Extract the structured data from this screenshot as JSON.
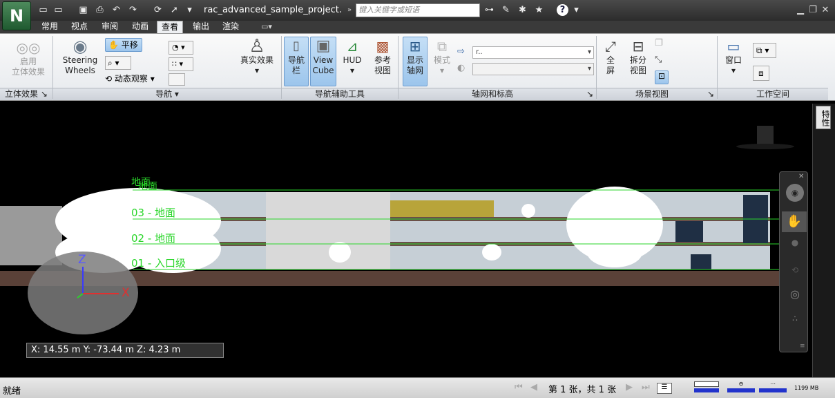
{
  "titlebar": {
    "app_logo": "N",
    "document_title": "rac_advanced_sample_project.n...",
    "search_placeholder": "键入关键字或短语",
    "qa_icons": [
      "new-icon",
      "open-icon",
      "save-icon",
      "print-icon",
      "undo-icon",
      "redo-icon",
      "refresh-icon",
      "select-icon",
      "dropdown-icon"
    ],
    "right_icons": [
      "binoculars-icon",
      "tools-icon",
      "satellite-icon",
      "star-icon",
      "help-icon"
    ]
  },
  "tabs": [
    {
      "label": "常用"
    },
    {
      "label": "视点"
    },
    {
      "label": "审阅"
    },
    {
      "label": "动画"
    },
    {
      "label": "查看",
      "active": true
    },
    {
      "label": "输出"
    },
    {
      "label": "渲染"
    }
  ],
  "ribbon": {
    "stereo": {
      "label1": "启用",
      "label2": "立体效果",
      "group": "立体效果"
    },
    "navigation": {
      "steering_line1": "Steering",
      "steering_line2": "Wheels",
      "pan": "平移",
      "orbit": "动态观察",
      "realism": "真实效果",
      "group": "导航"
    },
    "nav_tools": {
      "navbar1": "导航",
      "navbar2": "栏",
      "viewcube1": "View",
      "viewcube2": "Cube",
      "hud": "HUD",
      "ref1": "参考",
      "ref2": "视图",
      "group": "导航辅助工具"
    },
    "grid": {
      "show1": "显示",
      "show2": "轴网",
      "mode": "模式",
      "combo_value": "r..",
      "group": "轴网和标高"
    },
    "scene_view": {
      "full1": "全",
      "full2": "屏",
      "split1": "拆分",
      "split2": "视图",
      "group": "场景视图"
    },
    "workspace": {
      "window": "窗口",
      "group": "工作空间"
    }
  },
  "scene": {
    "levels": [
      {
        "label": "地面",
        "top_label": "地面"
      },
      {
        "label": "03 - 地面"
      },
      {
        "label": "02 - 地面"
      },
      {
        "label": "01 - 入口级"
      }
    ],
    "axes": {
      "z": "Z",
      "x": "X"
    },
    "coords": "X: 14.55 m  Y: -73.44 m  Z: 4.23 m",
    "colors": {
      "level_line": "#2ad62a",
      "ground": "#5a4138",
      "sky": "#000000"
    }
  },
  "side_panel": {
    "properties": "特性"
  },
  "statusbar": {
    "status": "就绪",
    "page_info": "第 1 张，共 1 张",
    "memory": "1199 MB"
  }
}
